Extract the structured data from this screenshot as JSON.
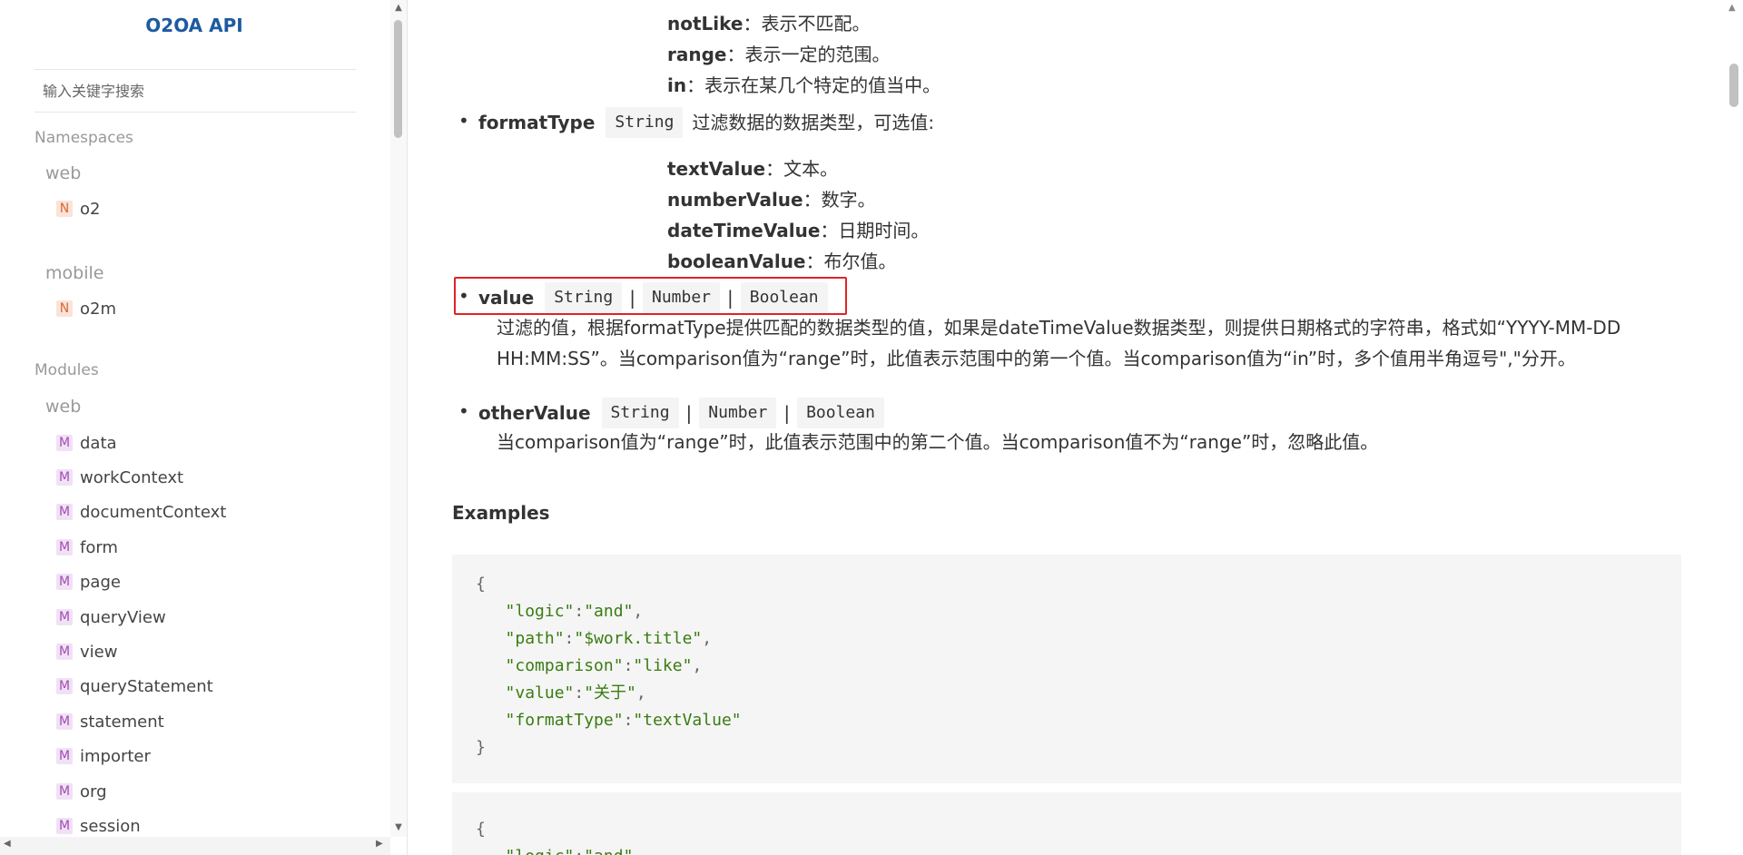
{
  "sidebar": {
    "title": "O2OA API",
    "search_placeholder": "输入关键字搜索",
    "namespaces_label": "Namespaces",
    "modules_label": "Modules",
    "groups": {
      "web": "web",
      "mobile": "mobile",
      "modules_web": "web"
    },
    "namespace_items": [
      {
        "badge": "N",
        "label": "o2"
      },
      {
        "badge": "N",
        "label": "o2m"
      }
    ],
    "module_items": [
      {
        "badge": "M",
        "label": "data"
      },
      {
        "badge": "M",
        "label": "workContext"
      },
      {
        "badge": "M",
        "label": "documentContext"
      },
      {
        "badge": "M",
        "label": "form"
      },
      {
        "badge": "M",
        "label": "page"
      },
      {
        "badge": "M",
        "label": "queryView"
      },
      {
        "badge": "M",
        "label": "view"
      },
      {
        "badge": "M",
        "label": "queryStatement"
      },
      {
        "badge": "M",
        "label": "statement"
      },
      {
        "badge": "M",
        "label": "importer"
      },
      {
        "badge": "M",
        "label": "org"
      },
      {
        "badge": "M",
        "label": "session"
      }
    ]
  },
  "main": {
    "comparison_values": [
      {
        "name": "notLike",
        "desc": "表示不匹配。"
      },
      {
        "name": "range",
        "desc": "表示一定的范围。"
      },
      {
        "name": "in",
        "desc": "表示在某几个特定的值当中。"
      }
    ],
    "formatType": {
      "name": "formatType",
      "type": "String",
      "desc": "过滤数据的数据类型，可选值:"
    },
    "format_values": [
      {
        "name": "textValue",
        "desc": "文本。"
      },
      {
        "name": "numberValue",
        "desc": "数字。"
      },
      {
        "name": "dateTimeValue",
        "desc": "日期时间。"
      },
      {
        "name": "booleanValue",
        "desc": "布尔值。"
      }
    ],
    "value": {
      "name": "value",
      "types": [
        "String",
        "Number",
        "Boolean"
      ],
      "desc_line1": "过滤的值，根据formatType提供匹配的数据类型的值，如果是dateTimeValue数据类型，则提供日期格式的字符串，格式如“YYYY-MM-DD",
      "desc_line2": "HH:MM:SS”。当comparison值为“range”时，此值表示范围中的第一个值。当comparison值为“in”时，多个值用半角逗号\",\"分开。"
    },
    "otherValue": {
      "name": "otherValue",
      "types": [
        "String",
        "Number",
        "Boolean"
      ],
      "desc": "当comparison值为“range”时，此值表示范围中的第二个值。当comparison值不为“range”时，忽略此值。"
    },
    "separator": "|",
    "colon": "：",
    "examples_heading": "Examples",
    "example1": {
      "open": "{",
      "lines": [
        {
          "key": "\"logic\"",
          "val": "\"and\"",
          "comma": ","
        },
        {
          "key": "\"path\"",
          "val": "\"$work.title\"",
          "comma": ","
        },
        {
          "key": "\"comparison\"",
          "val": "\"like\"",
          "comma": ","
        },
        {
          "key": "\"value\"",
          "val": "\"关于\"",
          "comma": ","
        },
        {
          "key": "\"formatType\"",
          "val": "\"textValue\"",
          "comma": ""
        }
      ],
      "close": "}"
    },
    "example2": {
      "open": "{",
      "first_line": {
        "key": "\"logic\"",
        "val": "\"and\"",
        "comma": ","
      }
    }
  },
  "scroll_glyphs": {
    "up": "▲",
    "down": "▼",
    "left": "◀",
    "right": "▶"
  }
}
